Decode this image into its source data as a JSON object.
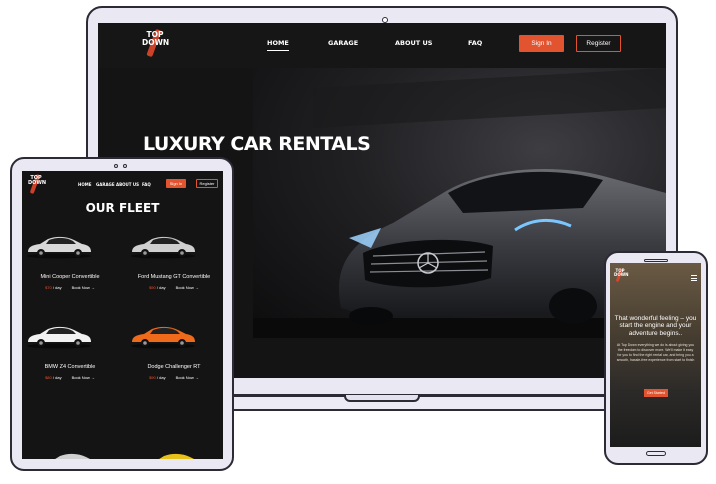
{
  "brand": {
    "line1": "TOP",
    "line2": "DOWN"
  },
  "laptop": {
    "nav": [
      "HOME",
      "GARAGE",
      "ABOUT US",
      "FAQ"
    ],
    "sign_in": "Sign In",
    "register": "Register",
    "hero_title": "LUXURY CAR RENTALS"
  },
  "tablet": {
    "nav": [
      "HOME",
      "GARAGE",
      "ABOUT US",
      "FAQ"
    ],
    "sign_in": "Sign In",
    "register": "Register",
    "title": "OUR FLEET",
    "cars": [
      {
        "name": "Mini Cooper Convertible",
        "price": "$70",
        "unit": "/ day",
        "action": "Book Now",
        "color": "#d9d9d9"
      },
      {
        "name": "Ford Mustang GT Convertible",
        "price": "$90",
        "unit": "/ day",
        "action": "Book Now",
        "color": "#cfcfcf"
      },
      {
        "name": "BMW Z4 Convertible",
        "price": "$80",
        "unit": "/ day",
        "action": "Book Now",
        "color": "#f2f2f2"
      },
      {
        "name": "Dodge Challenger RT",
        "price": "$90",
        "unit": "/ day",
        "action": "Book Now",
        "color": "#ef6a1a"
      }
    ]
  },
  "phone": {
    "heading": "That wonderful feeling – you start the engine and your adventure begins..",
    "body": "At Top Down everything we do is about giving you the freedom to discover more. We'll make it easy for you to find the right rental car, and bring you a smooth, hassle-free experience from start to finish",
    "cta": "Get Started"
  },
  "colors": {
    "accent": "#e2532f",
    "bg": "#141414"
  }
}
